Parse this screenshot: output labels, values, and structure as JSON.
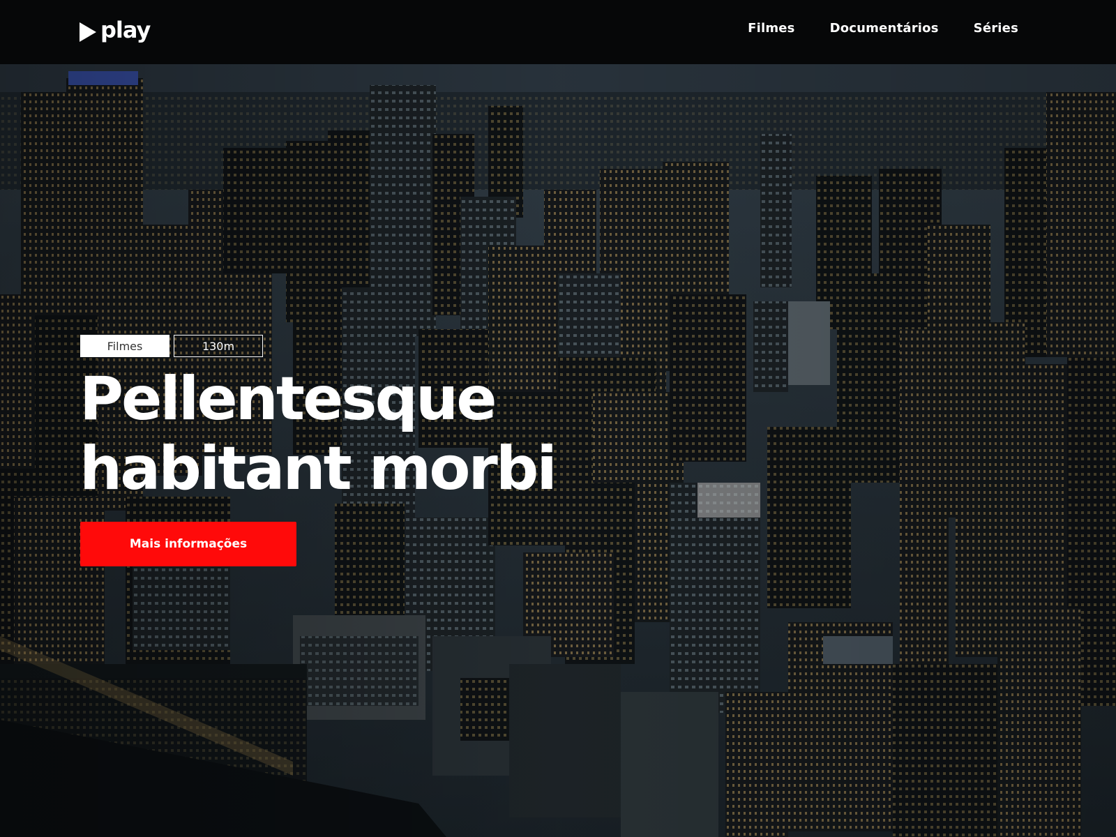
{
  "header": {
    "logo_text": "play",
    "logo_icon": "play-triangle-icon",
    "nav": [
      {
        "label": "Filmes"
      },
      {
        "label": "Documentários"
      },
      {
        "label": "Séries"
      }
    ]
  },
  "hero": {
    "background_image": "aerial-city-night",
    "tags": {
      "genre": "Filmes",
      "duration": "130m"
    },
    "title_line1": "Pellentesque",
    "title_line2": "habitant morbi",
    "cta_label": "Mais informações"
  },
  "colors": {
    "header_bg": "#060708",
    "accent": "#ff0a0a",
    "text": "#ffffff"
  }
}
